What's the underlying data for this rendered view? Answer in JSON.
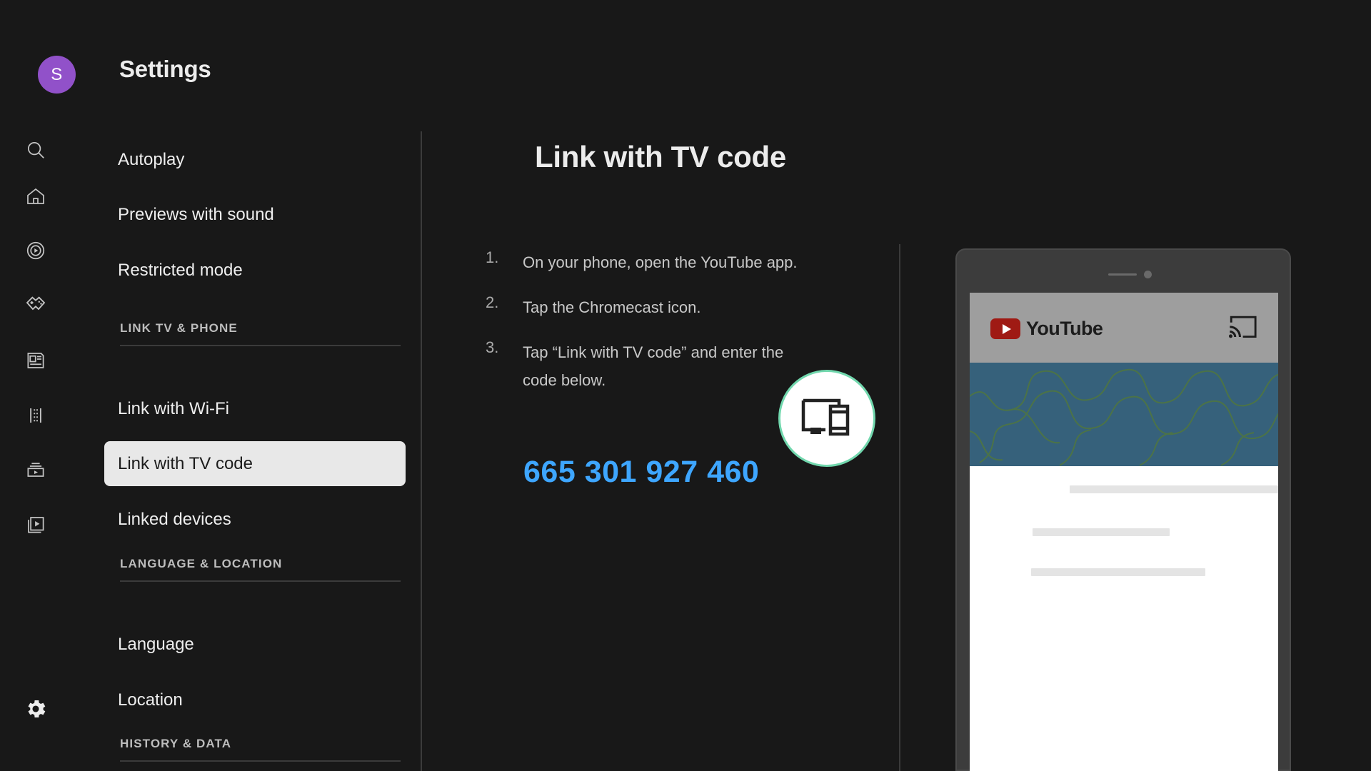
{
  "header": {
    "avatar_initial": "S",
    "avatar_color": "#9151C9",
    "title": "Settings"
  },
  "rail": {
    "icons": [
      {
        "name": "search-icon",
        "label": "Search"
      },
      {
        "name": "home-icon",
        "label": "Home"
      },
      {
        "name": "trending-icon",
        "label": "Trending"
      },
      {
        "name": "gaming-icon",
        "label": "Gaming"
      },
      {
        "name": "news-icon",
        "label": "News"
      },
      {
        "name": "film-strip-icon",
        "label": "Movies"
      },
      {
        "name": "subscriptions-icon",
        "label": "Subscriptions"
      },
      {
        "name": "library-icon",
        "label": "Library"
      }
    ],
    "bottom_icon": {
      "name": "gear-icon",
      "label": "Settings"
    }
  },
  "sidebar": {
    "items": [
      {
        "type": "item",
        "label": "Autoplay",
        "selected": false
      },
      {
        "type": "item",
        "label": "Previews with sound",
        "selected": false
      },
      {
        "type": "item",
        "label": "Restricted mode",
        "selected": false
      },
      {
        "type": "section",
        "label": "LINK TV & PHONE"
      },
      {
        "type": "item",
        "label": "Link with Wi-Fi",
        "selected": false
      },
      {
        "type": "item",
        "label": "Link with TV code",
        "selected": true
      },
      {
        "type": "item",
        "label": "Linked devices",
        "selected": false
      },
      {
        "type": "section",
        "label": "LANGUAGE & LOCATION"
      },
      {
        "type": "item",
        "label": "Language",
        "selected": false
      },
      {
        "type": "item",
        "label": "Location",
        "selected": false
      },
      {
        "type": "section",
        "label": "HISTORY & DATA"
      }
    ]
  },
  "main": {
    "title": "Link with TV code",
    "steps": [
      {
        "num": "1.",
        "text": "On your phone, open the YouTube app."
      },
      {
        "num": "2.",
        "text": "Tap the Chromecast icon."
      },
      {
        "num": "3.",
        "text": "Tap “Link with TV code” and enter the code below."
      }
    ],
    "tv_code": "665 301 927 460",
    "tv_code_color": "#3EA6FF"
  },
  "phone_mock": {
    "app_name": "YouTube",
    "cast_icon_name": "chromecast-icon",
    "highlight_icon_name": "link-tv-phone-icon",
    "highlight_ring_color": "#71D7AD",
    "thumbnail_color": "#36617B",
    "app_bar_color": "#9E9E9E"
  }
}
